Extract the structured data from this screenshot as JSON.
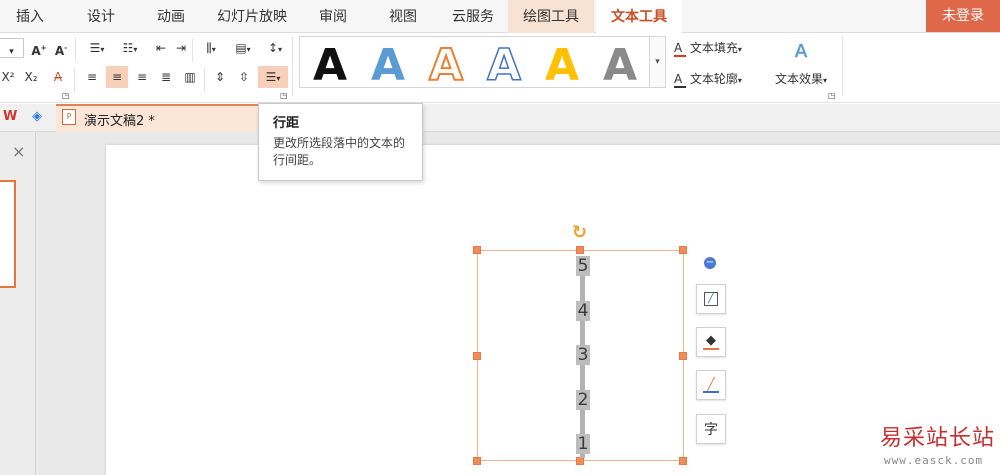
{
  "menu": {
    "tabs": [
      "插入",
      "设计",
      "动画",
      "幻灯片放映",
      "审阅",
      "视图",
      "云服务",
      "绘图工具",
      "文本工具"
    ],
    "login": "未登录"
  },
  "ribbon": {
    "text_styles": [
      {
        "glyph": "A",
        "color": "#111111",
        "outline": "none"
      },
      {
        "glyph": "A",
        "color": "#5b9bd5",
        "outline": "none"
      },
      {
        "glyph": "A",
        "color": "#ffffff",
        "outline": "#ed7d31"
      },
      {
        "glyph": "A",
        "color": "#ffffff",
        "outline": "#4472c4"
      },
      {
        "glyph": "A",
        "color": "#ffc000",
        "outline": "none"
      },
      {
        "glyph": "A",
        "color": "#8a8a8a",
        "outline": "none"
      }
    ],
    "text_fill": "文本填充",
    "text_outline": "文本轮廓",
    "text_effect": "文本效果",
    "superscript": "X²",
    "subscript": "X₂"
  },
  "docbar": {
    "doc_title": "演示文稿2 *"
  },
  "tooltip": {
    "title": "行距",
    "description": "更改所选段落中的文本的行间距。"
  },
  "slide": {
    "numbers": [
      "5",
      "4",
      "3",
      "2",
      "1"
    ]
  },
  "watermark": {
    "text": "易采站长站",
    "url": "www.easck.com"
  },
  "colors": {
    "accent": "#e0684a",
    "active_tab_text": "#c9502a",
    "selection_handle": "#f08c5a"
  }
}
